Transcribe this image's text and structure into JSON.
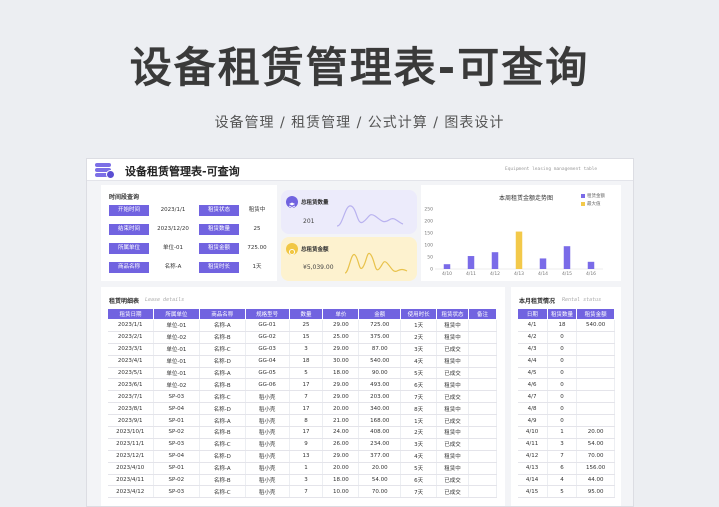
{
  "hero": {
    "title": "设备租赁管理表-可查询",
    "subtitle": "设备管理 / 租赁管理 / 公式计算 / 图表设计"
  },
  "sheet": {
    "title": "设备租赁管理表-可查询",
    "title_en": "Equipment leasing management table"
  },
  "query": {
    "title": "时间段查询",
    "rows": [
      {
        "l1": "开始时间",
        "v1": "2023/1/1",
        "l2": "租赁状态",
        "v2": "租赁中"
      },
      {
        "l1": "结束时间",
        "v1": "2023/12/20",
        "l2": "租赁数量",
        "v2": "25"
      },
      {
        "l1": "所属单位",
        "v1": "单位-01",
        "l2": "租赁金额",
        "v2": "725.00"
      },
      {
        "l1": "商品名称",
        "v1": "名称-A",
        "l2": "租赁时长",
        "v2": "1天"
      }
    ]
  },
  "cards": {
    "qty": {
      "title": "总租赁数量",
      "value": "201"
    },
    "amount": {
      "title": "总租赁金额",
      "value": "¥5,039.00"
    }
  },
  "chart_data": {
    "type": "bar",
    "title": "本周租赁金额走势图",
    "categories": [
      "4/10",
      "4/11",
      "4/12",
      "4/13",
      "4/14",
      "4/15",
      "4/16"
    ],
    "series": [
      {
        "name": "租赁金额",
        "values": [
          20,
          54,
          70,
          156,
          44,
          95,
          30
        ]
      }
    ],
    "highlight_name": "最大值",
    "highlight_index": 3,
    "yticks": [
      0,
      50,
      100,
      150,
      200,
      250
    ],
    "ylim": [
      0,
      250
    ],
    "colors": {
      "bar": "#7a6be8",
      "max": "#f3c94a"
    },
    "legend_position": "top-right"
  },
  "details": {
    "title": "租赁明细表",
    "title_en": "Lease details",
    "headers": [
      "租赁日期",
      "所属单位",
      "商品名称",
      "规格型号",
      "数量",
      "单价",
      "金额",
      "使用时长",
      "租赁状态",
      "备注"
    ],
    "rows": [
      [
        "2023/1/1",
        "单位-01",
        "名称-A",
        "GG-01",
        "25",
        "29.00",
        "725.00",
        "1天",
        "租赁中",
        ""
      ],
      [
        "2023/2/1",
        "单位-02",
        "名称-B",
        "GG-02",
        "15",
        "25.00",
        "375.00",
        "2天",
        "租赁中",
        ""
      ],
      [
        "2023/3/1",
        "单位-01",
        "名称-C",
        "GG-03",
        "3",
        "29.00",
        "87.00",
        "3天",
        "已成交",
        ""
      ],
      [
        "2023/4/1",
        "单位-01",
        "名称-D",
        "GG-04",
        "18",
        "30.00",
        "540.00",
        "4天",
        "租赁中",
        ""
      ],
      [
        "2023/5/1",
        "单位-01",
        "名称-A",
        "GG-05",
        "5",
        "18.00",
        "90.00",
        "5天",
        "已成交",
        ""
      ],
      [
        "2023/6/1",
        "单位-02",
        "名称-B",
        "GG-06",
        "17",
        "29.00",
        "493.00",
        "6天",
        "租赁中",
        ""
      ],
      [
        "2023/7/1",
        "SP-03",
        "名称-C",
        "稻小壳",
        "7",
        "29.00",
        "203.00",
        "7天",
        "已成交",
        ""
      ],
      [
        "2023/8/1",
        "SP-04",
        "名称-D",
        "稻小壳",
        "17",
        "20.00",
        "340.00",
        "8天",
        "租赁中",
        ""
      ],
      [
        "2023/9/1",
        "SP-01",
        "名称-A",
        "稻小壳",
        "8",
        "21.00",
        "168.00",
        "1天",
        "已成交",
        ""
      ],
      [
        "2023/10/1",
        "SP-02",
        "名称-B",
        "稻小壳",
        "17",
        "24.00",
        "408.00",
        "2天",
        "租赁中",
        ""
      ],
      [
        "2023/11/1",
        "SP-03",
        "名称-C",
        "稻小壳",
        "9",
        "26.00",
        "234.00",
        "3天",
        "已成交",
        ""
      ],
      [
        "2023/12/1",
        "SP-04",
        "名称-D",
        "稻小壳",
        "13",
        "29.00",
        "377.00",
        "4天",
        "租赁中",
        ""
      ],
      [
        "2023/4/10",
        "SP-01",
        "名称-A",
        "稻小壳",
        "1",
        "20.00",
        "20.00",
        "5天",
        "租赁中",
        ""
      ],
      [
        "2023/4/11",
        "SP-02",
        "名称-B",
        "稻小壳",
        "3",
        "18.00",
        "54.00",
        "6天",
        "已成交",
        ""
      ],
      [
        "2023/4/12",
        "SP-03",
        "名称-C",
        "稻小壳",
        "7",
        "10.00",
        "70.00",
        "7天",
        "已成交",
        ""
      ]
    ]
  },
  "monthly": {
    "title": "本月租赁情况",
    "title_en": "Rental status",
    "headers": [
      "日期",
      "租赁数量",
      "租赁金额"
    ],
    "rows": [
      [
        "4/1",
        "18",
        "540.00"
      ],
      [
        "4/2",
        "0",
        ""
      ],
      [
        "4/3",
        "0",
        ""
      ],
      [
        "4/4",
        "0",
        ""
      ],
      [
        "4/5",
        "0",
        ""
      ],
      [
        "4/6",
        "0",
        ""
      ],
      [
        "4/7",
        "0",
        ""
      ],
      [
        "4/8",
        "0",
        ""
      ],
      [
        "4/9",
        "0",
        ""
      ],
      [
        "4/10",
        "1",
        "20.00"
      ],
      [
        "4/11",
        "3",
        "54.00"
      ],
      [
        "4/12",
        "7",
        "70.00"
      ],
      [
        "4/13",
        "6",
        "156.00"
      ],
      [
        "4/14",
        "4",
        "44.00"
      ],
      [
        "4/15",
        "5",
        "95.00"
      ]
    ]
  }
}
